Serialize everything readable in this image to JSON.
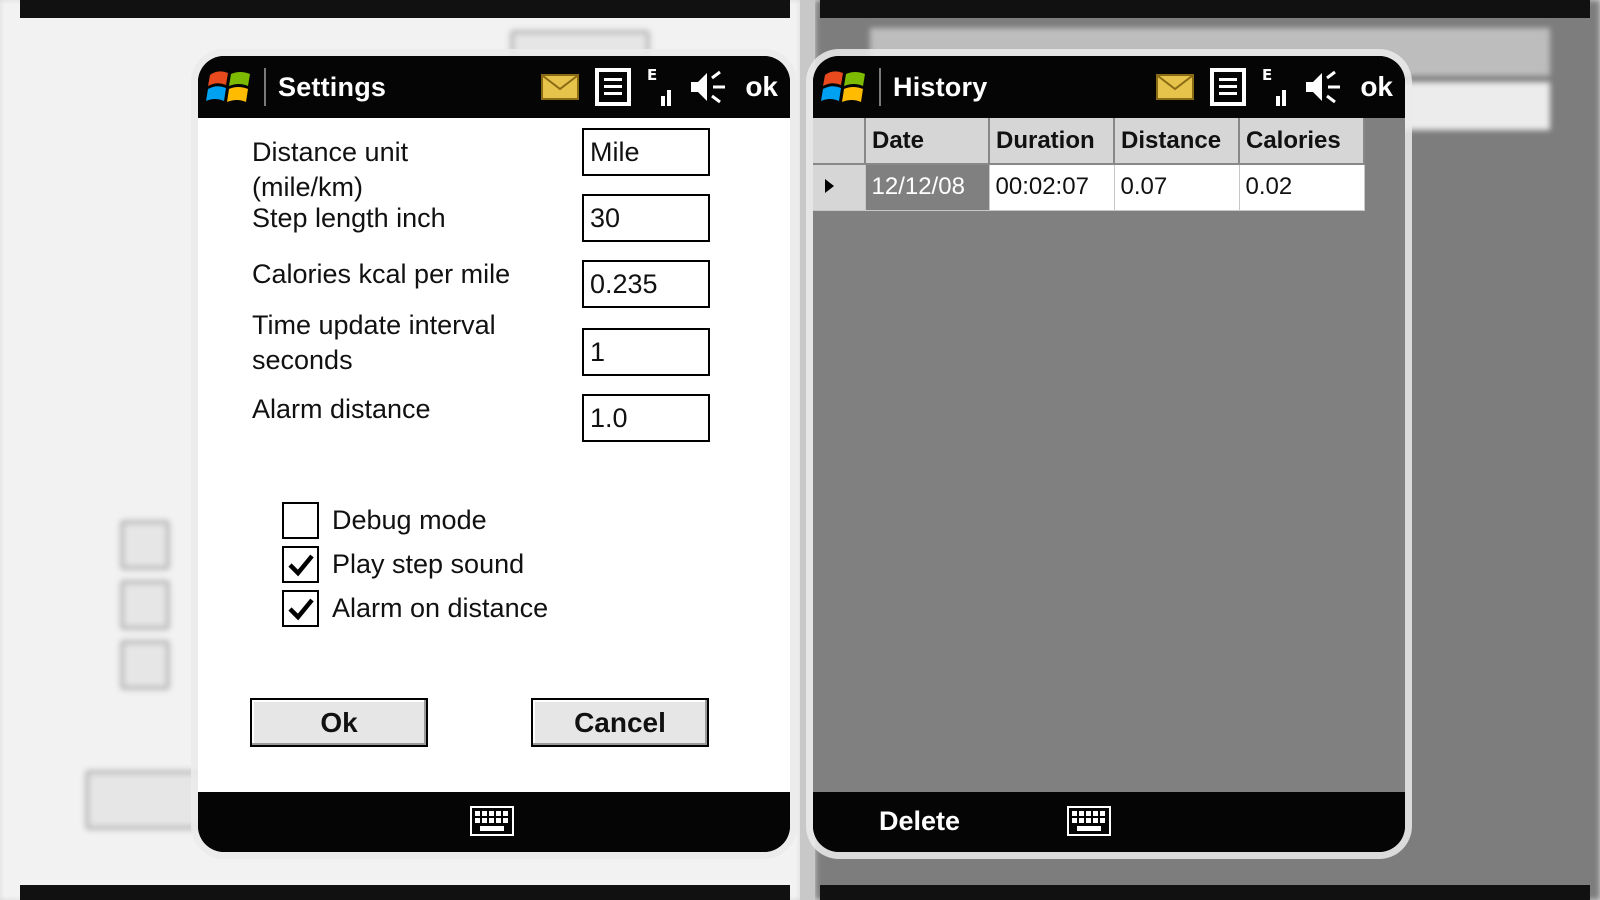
{
  "settings": {
    "title": "Settings",
    "ok_label": "ok",
    "fields": [
      {
        "label_line1": "Distance unit",
        "label_line2": "(mile/km)",
        "value": "Mile"
      },
      {
        "label_line1": "Step length inch",
        "label_line2": "",
        "value": "30"
      },
      {
        "label_line1": "Calories kcal per mile",
        "label_line2": "",
        "value": "0.235"
      },
      {
        "label_line1": "Time update interval",
        "label_line2": "seconds",
        "value": "1"
      },
      {
        "label_line1": "Alarm distance",
        "label_line2": "",
        "value": "1.0"
      }
    ],
    "checks": [
      {
        "label": "Debug mode",
        "checked": false
      },
      {
        "label": "Play step sound",
        "checked": true
      },
      {
        "label": "Alarm on distance",
        "checked": true
      }
    ],
    "ok_button": "Ok",
    "cancel_button": "Cancel"
  },
  "history": {
    "title": "History",
    "ok_label": "ok",
    "columns": [
      "Date",
      "Duration",
      "Distance",
      "Calories"
    ],
    "rows": [
      {
        "date": "12/12/08",
        "duration": "00:02:07",
        "distance": "0.07",
        "calories": "0.02"
      }
    ],
    "delete_label": "Delete"
  },
  "colors": {
    "titlebar": "#050505",
    "grid_background": "#808080",
    "selected_cell": "#808080",
    "header_cell": "#d6d6d6"
  },
  "icons": [
    "windows-start-icon",
    "mail-icon",
    "list-icon",
    "connectivity-icon",
    "speaker-icon",
    "keyboard-icon",
    "checkmark-icon"
  ]
}
